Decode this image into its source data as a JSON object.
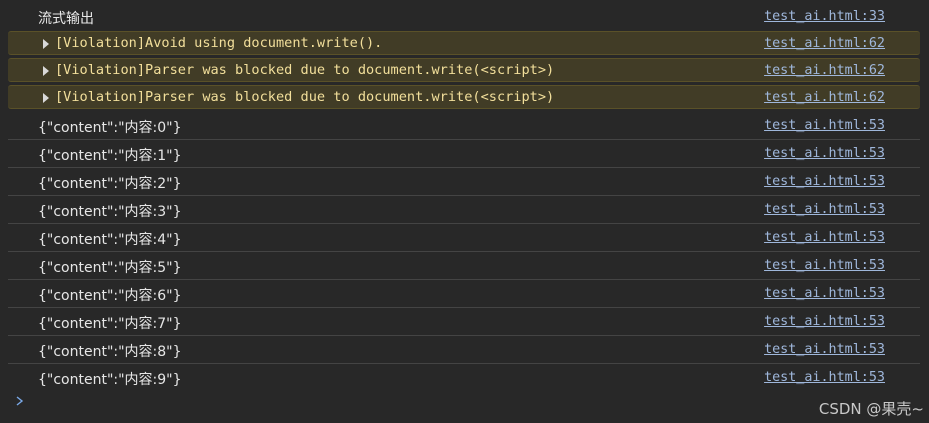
{
  "console": {
    "header": {
      "text": "流式输出",
      "source": "test_ai.html:33"
    },
    "violations": [
      {
        "text": "[Violation]Avoid using document.write().",
        "source": "test_ai.html:62"
      },
      {
        "text": "[Violation]Parser was blocked due to document.write(<script>)",
        "source": "test_ai.html:62"
      },
      {
        "text": "[Violation]Parser was blocked due to document.write(<script>)",
        "source": "test_ai.html:62"
      }
    ],
    "logs": [
      {
        "text": "{\"content\":\"内容:0\"}",
        "source": "test_ai.html:53"
      },
      {
        "text": "{\"content\":\"内容:1\"}",
        "source": "test_ai.html:53"
      },
      {
        "text": "{\"content\":\"内容:2\"}",
        "source": "test_ai.html:53"
      },
      {
        "text": "{\"content\":\"内容:3\"}",
        "source": "test_ai.html:53"
      },
      {
        "text": "{\"content\":\"内容:4\"}",
        "source": "test_ai.html:53"
      },
      {
        "text": "{\"content\":\"内容:5\"}",
        "source": "test_ai.html:53"
      },
      {
        "text": "{\"content\":\"内容:6\"}",
        "source": "test_ai.html:53"
      },
      {
        "text": "{\"content\":\"内容:7\"}",
        "source": "test_ai.html:53"
      },
      {
        "text": "{\"content\":\"内容:8\"}",
        "source": "test_ai.html:53"
      },
      {
        "text": "{\"content\":\"内容:9\"}",
        "source": "test_ai.html:53"
      }
    ],
    "prompt_icon": "chevron-right-icon",
    "watermark": "CSDN @果壳~"
  },
  "colors": {
    "background": "#282828",
    "violation_bg": "#413c26",
    "violation_text": "#f2df9b",
    "link": "#9fb7db",
    "prompt": "#7aa9e8"
  }
}
